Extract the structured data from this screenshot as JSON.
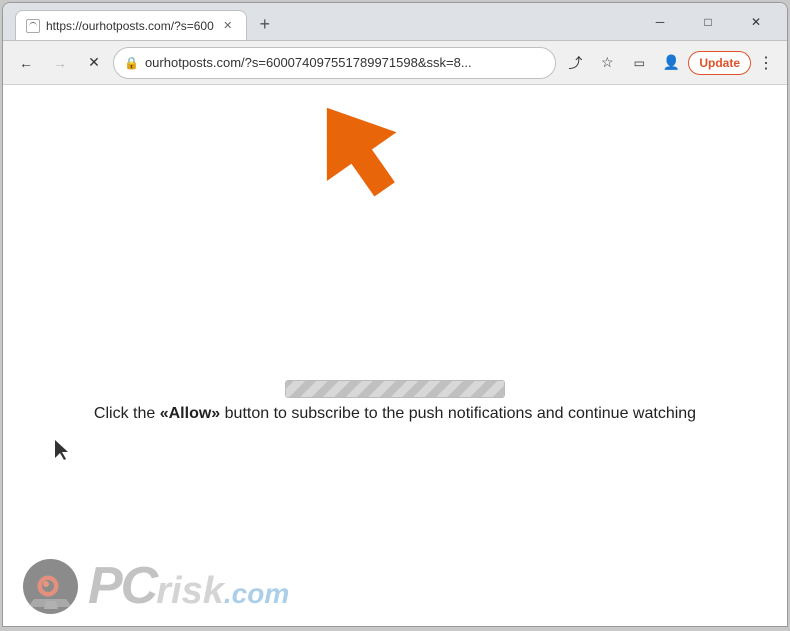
{
  "window": {
    "title": "https://ourhotposts.com/?s=600...",
    "controls": {
      "minimize": "─",
      "maximize": "□",
      "close": "✕"
    }
  },
  "tab": {
    "favicon_alt": "page-favicon",
    "title": "https://ourhotposts.com/?s=600",
    "close_label": "✕"
  },
  "new_tab_button": "+",
  "nav": {
    "back_label": "←",
    "forward_label": "→",
    "reload_label": "✕",
    "lock_icon": "🔒",
    "address": "ourhotposts.com/?s=600074097551789971598&ssk=8...",
    "share_icon": "⤴",
    "bookmark_icon": "☆",
    "sidebar_icon": "▭",
    "profile_icon": "👤",
    "update_label": "Update",
    "more_icon": "⋮"
  },
  "page": {
    "message": "Click the «Allow» button to subscribe to the push notifications and continue watching",
    "message_parts": {
      "before": "Click the ",
      "allow": "«Allow»",
      "after": " button to subscribe to the push notifications and continue watching"
    },
    "progress_alt": "loading-progress-bar"
  },
  "watermark": {
    "logo_text": "PC",
    "logo_suffix": "risk",
    "domain": ".com",
    "alt": "pcrisk-logo"
  }
}
